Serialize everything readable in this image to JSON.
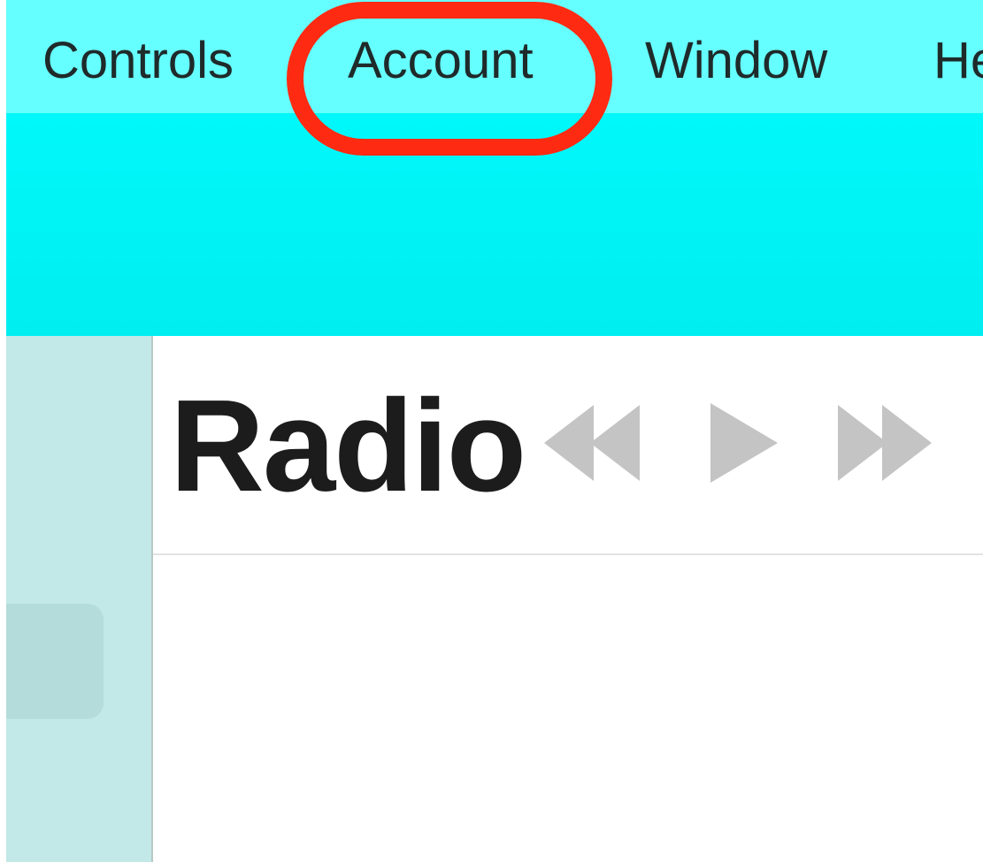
{
  "menu_bar": {
    "items": [
      {
        "label": "Controls"
      },
      {
        "label": "Account"
      },
      {
        "label": "Window"
      },
      {
        "label": "He"
      }
    ],
    "highlighted_item": "Account"
  },
  "player": {
    "icons": [
      "rewind-icon",
      "play-icon",
      "fast-forward-icon"
    ]
  },
  "main": {
    "title": "Radio"
  },
  "colors": {
    "menubar_bg": "#66ffff",
    "titlebar_bg": "#00f4f6",
    "sidebar_bg": "#c2e8e7",
    "highlight_ring": "#ff2a12",
    "control_gray": "#c4c4c4"
  }
}
